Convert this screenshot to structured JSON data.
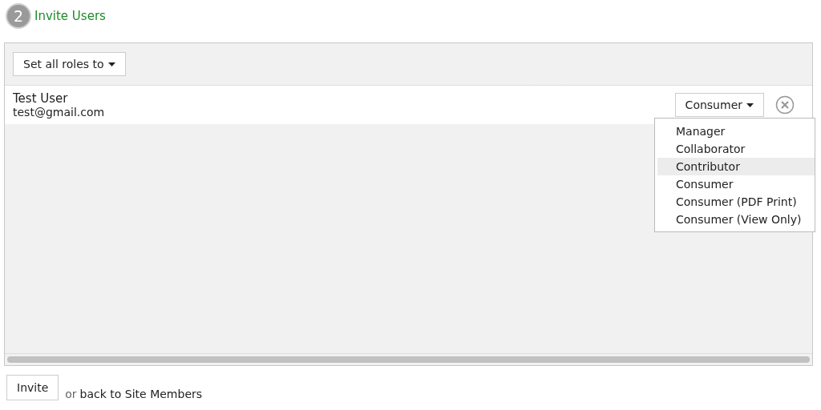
{
  "step": {
    "number": "2",
    "title": "Invite Users"
  },
  "toolbar": {
    "set_all_button": "Set all roles to"
  },
  "users": [
    {
      "name": "Test User",
      "email": "test@gmail.com",
      "role": "Consumer"
    }
  ],
  "role_menu": {
    "items": [
      {
        "label": "Manager",
        "highlighted": false
      },
      {
        "label": "Collaborator",
        "highlighted": false
      },
      {
        "label": "Contributor",
        "highlighted": true
      },
      {
        "label": "Consumer",
        "highlighted": false
      },
      {
        "label": "Consumer (PDF Print)",
        "highlighted": false
      },
      {
        "label": "Consumer (View Only)",
        "highlighted": false
      }
    ]
  },
  "footer": {
    "invite_button": "Invite",
    "or_text": "or",
    "back_link": "back to Site Members"
  }
}
